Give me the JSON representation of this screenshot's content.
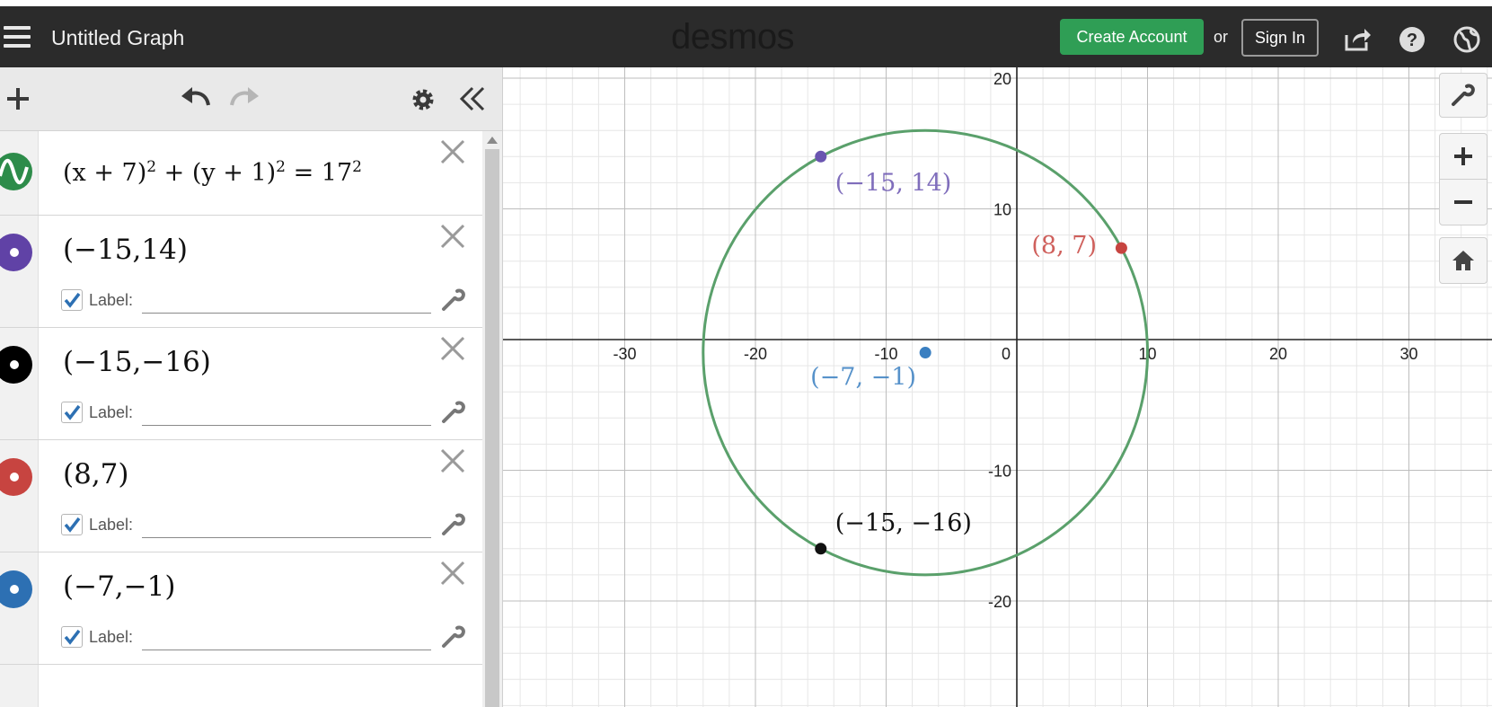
{
  "header": {
    "title": "Untitled Graph",
    "logo": "desmos",
    "create_account": "Create Account",
    "or": "or",
    "sign_in": "Sign In",
    "icons": [
      "menu-icon",
      "share-icon",
      "help-icon",
      "globe-icon"
    ]
  },
  "toolbar": {
    "icons": [
      "add-icon",
      "undo-icon",
      "redo-icon",
      "settings-icon",
      "collapse-icon"
    ]
  },
  "expressions": [
    {
      "color": "#2d8c4a",
      "latex_parts": [
        "(x + 7)",
        "2",
        " + (y + 1)",
        "2",
        " = 17",
        "2"
      ]
    },
    {
      "text": "(−15,14)",
      "color": "#6042a6",
      "label_text": "Label:",
      "label_value": ""
    },
    {
      "text": "(−15,−16)",
      "color": "#000000",
      "label_text": "Label:",
      "label_value": ""
    },
    {
      "text": "(8,7)",
      "color": "#c74440",
      "label_text": "Label:",
      "label_value": ""
    },
    {
      "text": "(−7,−1)",
      "color": "#2d70b3",
      "label_text": "Label:",
      "label_value": ""
    }
  ],
  "graph": {
    "x_ticks": [
      "-30",
      "-20",
      "-10",
      "0",
      "10",
      "20",
      "30"
    ],
    "y_ticks": [
      "20",
      "10",
      "-10",
      "-20"
    ],
    "circle": {
      "center": [
        -7,
        -1
      ],
      "radius": 17,
      "color": "#5aa06b"
    },
    "points": [
      {
        "coord": [
          -15,
          14
        ],
        "label": "(−15, 14)",
        "color": "#6a55b0"
      },
      {
        "coord": [
          -15,
          -16
        ],
        "label": "(−15, −16)",
        "color": "#111111"
      },
      {
        "coord": [
          8,
          7
        ],
        "label": "(8, 7)",
        "color": "#c74440"
      },
      {
        "coord": [
          -7,
          -1
        ],
        "label": "(−7, −1)",
        "color": "#3a7fc1"
      }
    ],
    "buttons": [
      "wrench-icon",
      "zoom-in-icon",
      "zoom-out-icon",
      "home-icon"
    ]
  }
}
